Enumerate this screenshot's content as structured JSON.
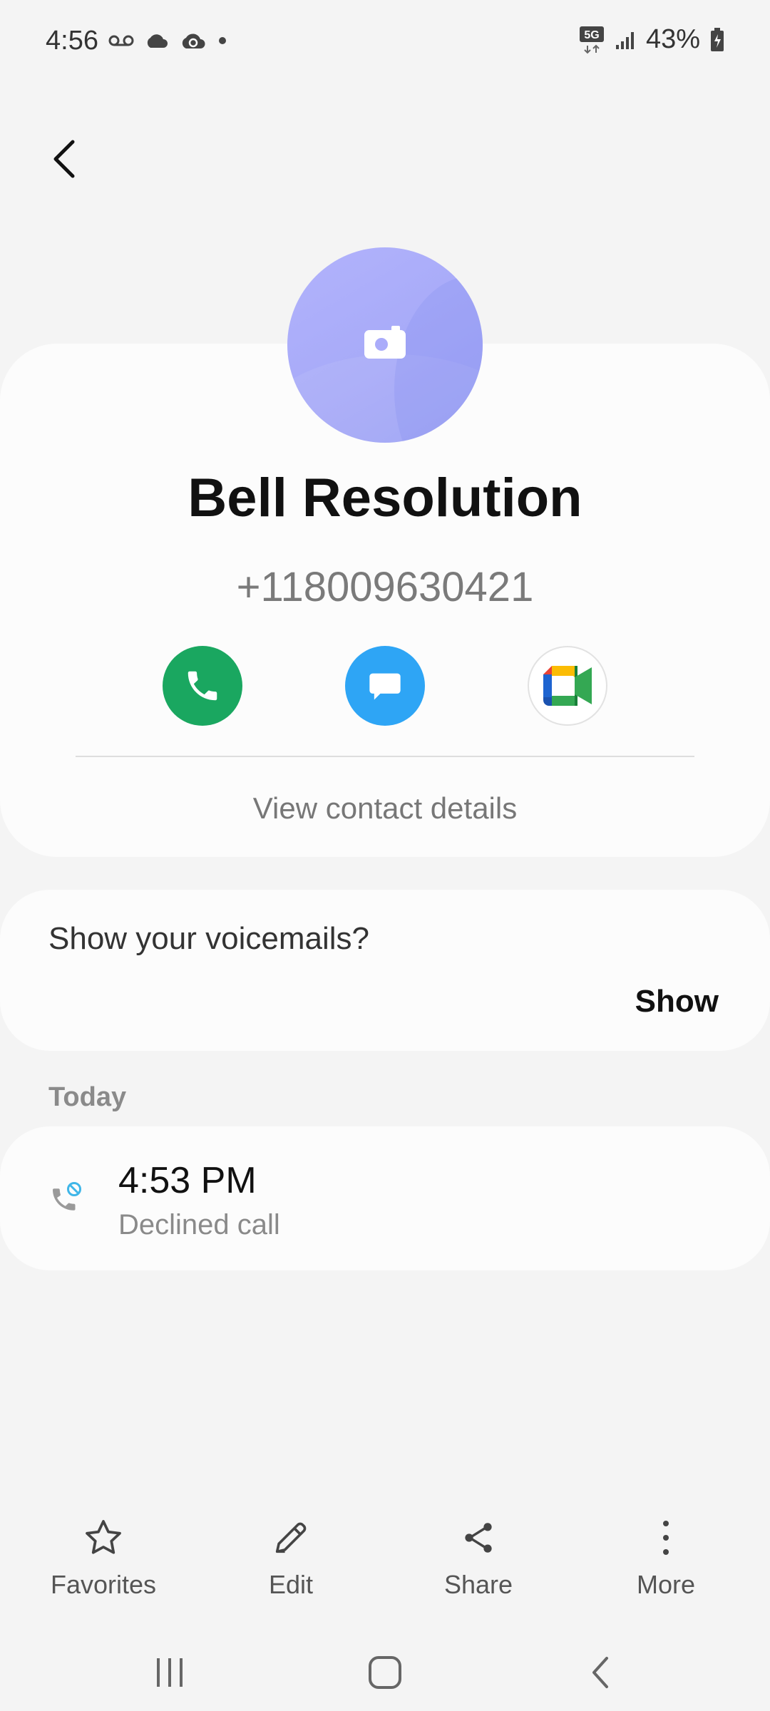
{
  "status_bar": {
    "time": "4:56",
    "network": "5G",
    "battery": "43%"
  },
  "contact": {
    "name": "Bell Resolution",
    "number": "+118009630421",
    "view_details_label": "View contact details"
  },
  "actions": {
    "call_icon": "phone-icon",
    "message_icon": "message-icon",
    "video_icon": "google-meet-icon"
  },
  "voicemail": {
    "prompt": "Show your voicemails?",
    "show_label": "Show"
  },
  "history": {
    "section_label": "Today",
    "entries": [
      {
        "time": "4:53 PM",
        "status": "Declined call",
        "icon": "declined-call-icon"
      }
    ]
  },
  "bottom_bar": {
    "favorites_label": "Favorites",
    "edit_label": "Edit",
    "share_label": "Share",
    "more_label": "More"
  },
  "colors": {
    "call_green": "#1aa760",
    "message_blue": "#2ea5f5",
    "avatar_purple": "#aaacfa"
  }
}
